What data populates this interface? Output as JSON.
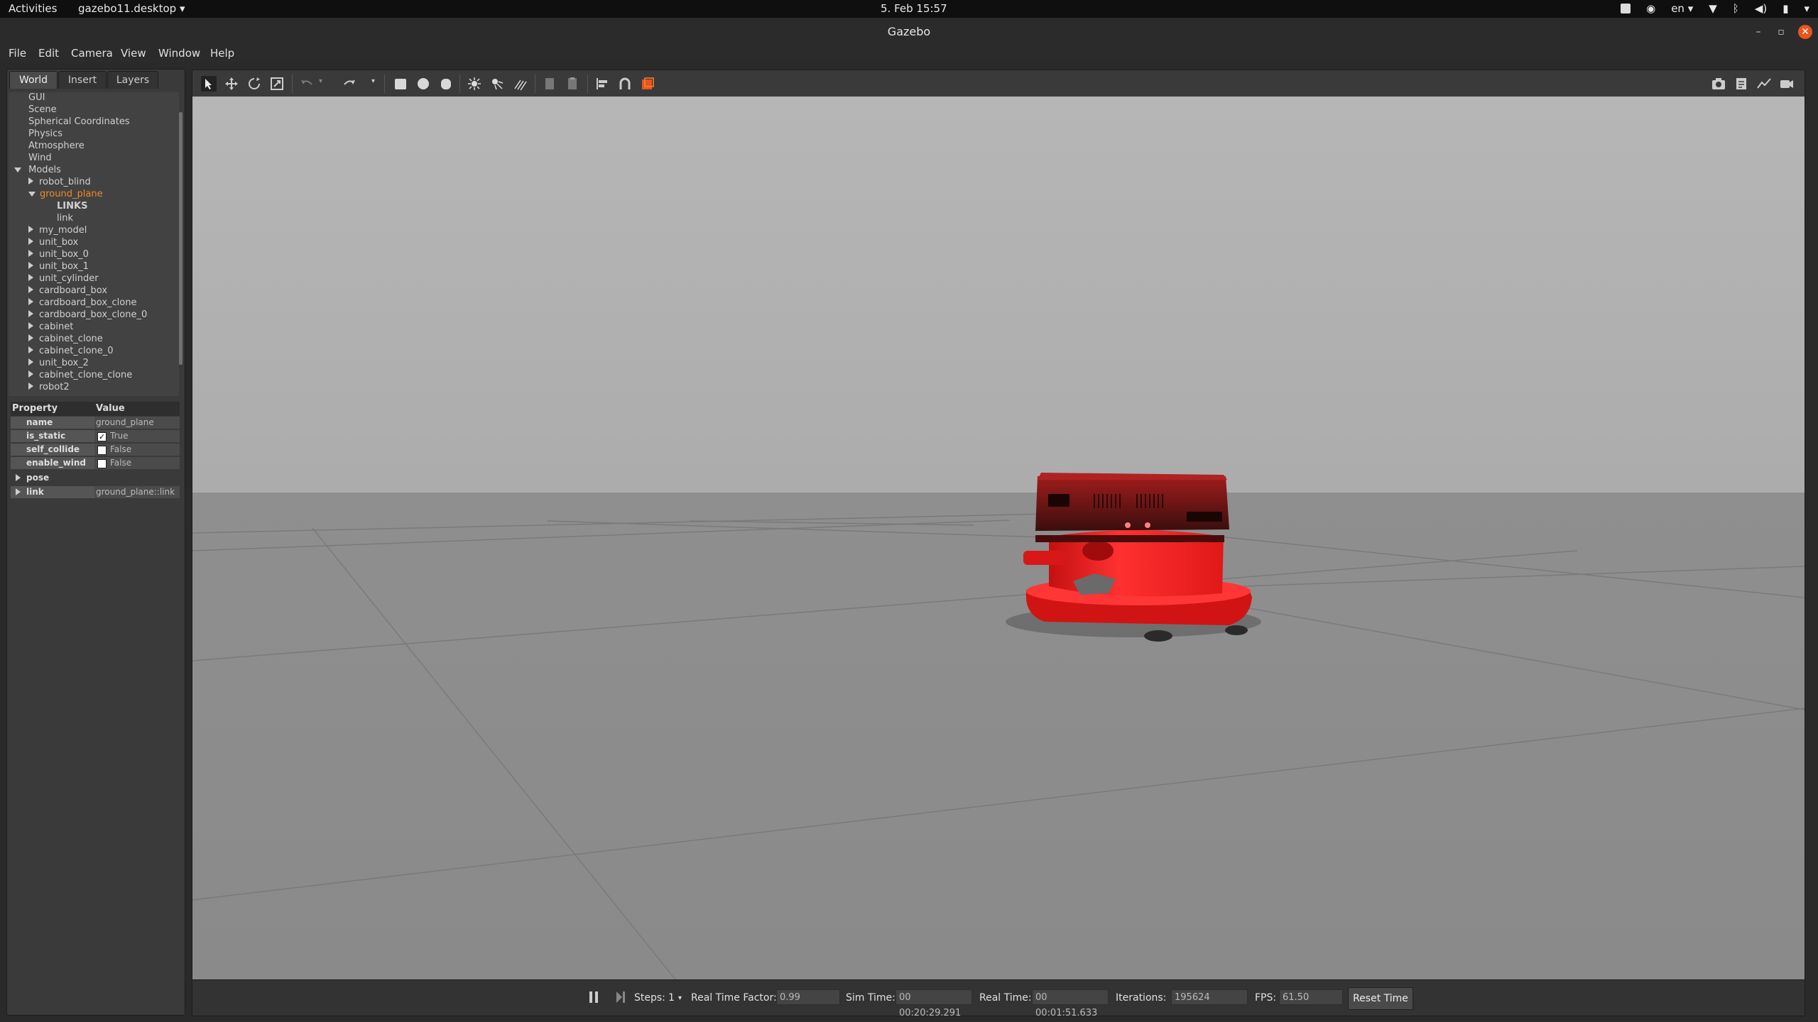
{
  "topbar": {
    "activities": "Activities",
    "app_name": "gazebo11.desktop",
    "clock": "5. Feb  15:57",
    "keyboard_layout": "en"
  },
  "window": {
    "title": "Gazebo"
  },
  "menubar": {
    "items": [
      {
        "label": "File"
      },
      {
        "label": "Edit"
      },
      {
        "label": "Camera"
      },
      {
        "label": "View"
      },
      {
        "label": "Window"
      },
      {
        "label": "Help"
      }
    ]
  },
  "left_panel": {
    "tabs": [
      {
        "label": "World",
        "active": true
      },
      {
        "label": "Insert",
        "active": false
      },
      {
        "label": "Layers",
        "active": false
      }
    ],
    "tree": {
      "top_items": [
        "GUI",
        "Scene",
        "Spherical Coordinates",
        "Physics",
        "Atmosphere",
        "Wind"
      ],
      "models_label": "Models",
      "models": [
        "robot_blind",
        "ground_plane",
        "my_model",
        "unit_box",
        "unit_box_0",
        "unit_box_1",
        "unit_cylinder",
        "cardboard_box",
        "cardboard_box_clone",
        "cardboard_box_clone_0",
        "cabinet",
        "cabinet_clone",
        "cabinet_clone_0",
        "unit_box_2",
        "cabinet_clone_clone",
        "robot2"
      ],
      "selected_model": "ground_plane",
      "links_label": "LINKS",
      "link_label": "link"
    },
    "properties": {
      "header_property": "Property",
      "header_value": "Value",
      "rows": [
        {
          "key": "name",
          "value": "ground_plane"
        },
        {
          "key": "is_static",
          "value": "True",
          "checked": true
        },
        {
          "key": "self_collide",
          "value": "False",
          "checked": false
        },
        {
          "key": "enable_wind",
          "value": "False",
          "checked": false
        },
        {
          "key": "pose",
          "value": ""
        },
        {
          "key": "link",
          "value": "ground_plane::link"
        }
      ]
    }
  },
  "toolbar": {
    "icons": [
      "select-arrow-icon",
      "translate-icon",
      "rotate-icon",
      "scale-icon",
      "undo-icon",
      "redo-icon",
      "box-icon",
      "sphere-icon",
      "cylinder-icon",
      "point-light-icon",
      "spot-light-icon",
      "directional-light-icon",
      "copy-icon",
      "paste-icon",
      "align-icon",
      "snap-icon",
      "view-angle-icon",
      "screenshot-icon",
      "log-icon",
      "plot-icon",
      "record-icon"
    ]
  },
  "bottom_bar": {
    "steps_label": "Steps:",
    "steps_value": "1",
    "rtf_label": "Real Time Factor:",
    "rtf_value": "0.99",
    "sim_time_label": "Sim Time:",
    "sim_time_value": "00 00:20:29.291",
    "real_time_label": "Real Time:",
    "real_time_value": "00 00:01:51.633",
    "iterations_label": "Iterations:",
    "iterations_value": "195624",
    "fps_label": "FPS:",
    "fps_value": "61.50",
    "reset_label": "Reset Time"
  },
  "colors": {
    "accent_orange": "#e95420",
    "selected_text": "#f08a24",
    "robot_red": "#ff2020",
    "sky": "#b3b3b3",
    "ground": "#8d8d8d"
  }
}
